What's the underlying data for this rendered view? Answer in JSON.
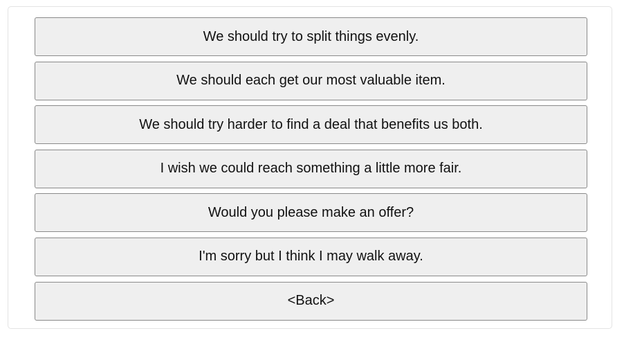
{
  "options": [
    {
      "label": "We should try to split things evenly."
    },
    {
      "label": "We should each get our most valuable item."
    },
    {
      "label": "We should try harder to find a deal that benefits us both."
    },
    {
      "label": "I wish we could reach something a little more fair."
    },
    {
      "label": "Would you please make an offer?"
    },
    {
      "label": "I'm sorry but I think I may walk away."
    },
    {
      "label": "<Back>"
    }
  ]
}
